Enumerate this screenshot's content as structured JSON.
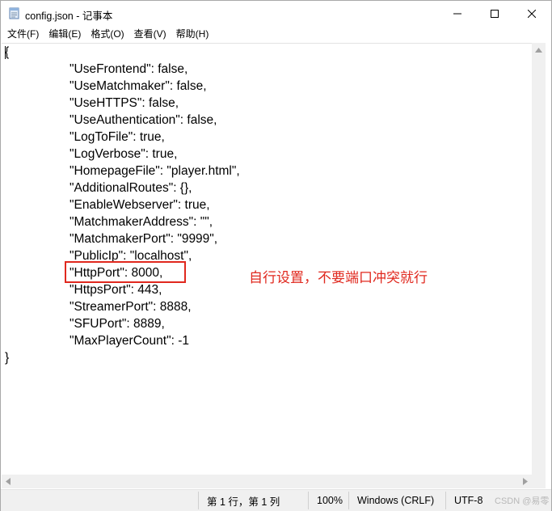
{
  "window": {
    "title": "config.json - 记事本"
  },
  "menu": [
    "文件(F)",
    "编辑(E)",
    "格式(O)",
    "查看(V)",
    "帮助(H)"
  ],
  "editor": {
    "lines": [
      "{",
      "\"UseFrontend\": false,",
      "\"UseMatchmaker\": false,",
      "\"UseHTTPS\": false,",
      "\"UseAuthentication\": false,",
      "\"LogToFile\": true,",
      "\"LogVerbose\": true,",
      "\"HomepageFile\": \"player.html\",",
      "\"AdditionalRoutes\": {},",
      "\"EnableWebserver\": true,",
      "\"MatchmakerAddress\": \"\",",
      "\"MatchmakerPort\": \"9999\",",
      "\"PublicIp\": \"localhost\",",
      "\"HttpPort\": 8000,",
      "\"HttpsPort\": 443,",
      "\"StreamerPort\": 8888,",
      "\"SFUPort\": 8889,",
      "\"MaxPlayerCount\": -1",
      "}"
    ],
    "annotation": "自行设置，不要端口冲突就行",
    "annotation_color": "#e0281e"
  },
  "statusbar": {
    "position": "第 1 行，第 1 列",
    "zoom": "100%",
    "line_ending": "Windows (CRLF)",
    "encoding": "UTF-8"
  },
  "watermark": "CSDN @易零"
}
